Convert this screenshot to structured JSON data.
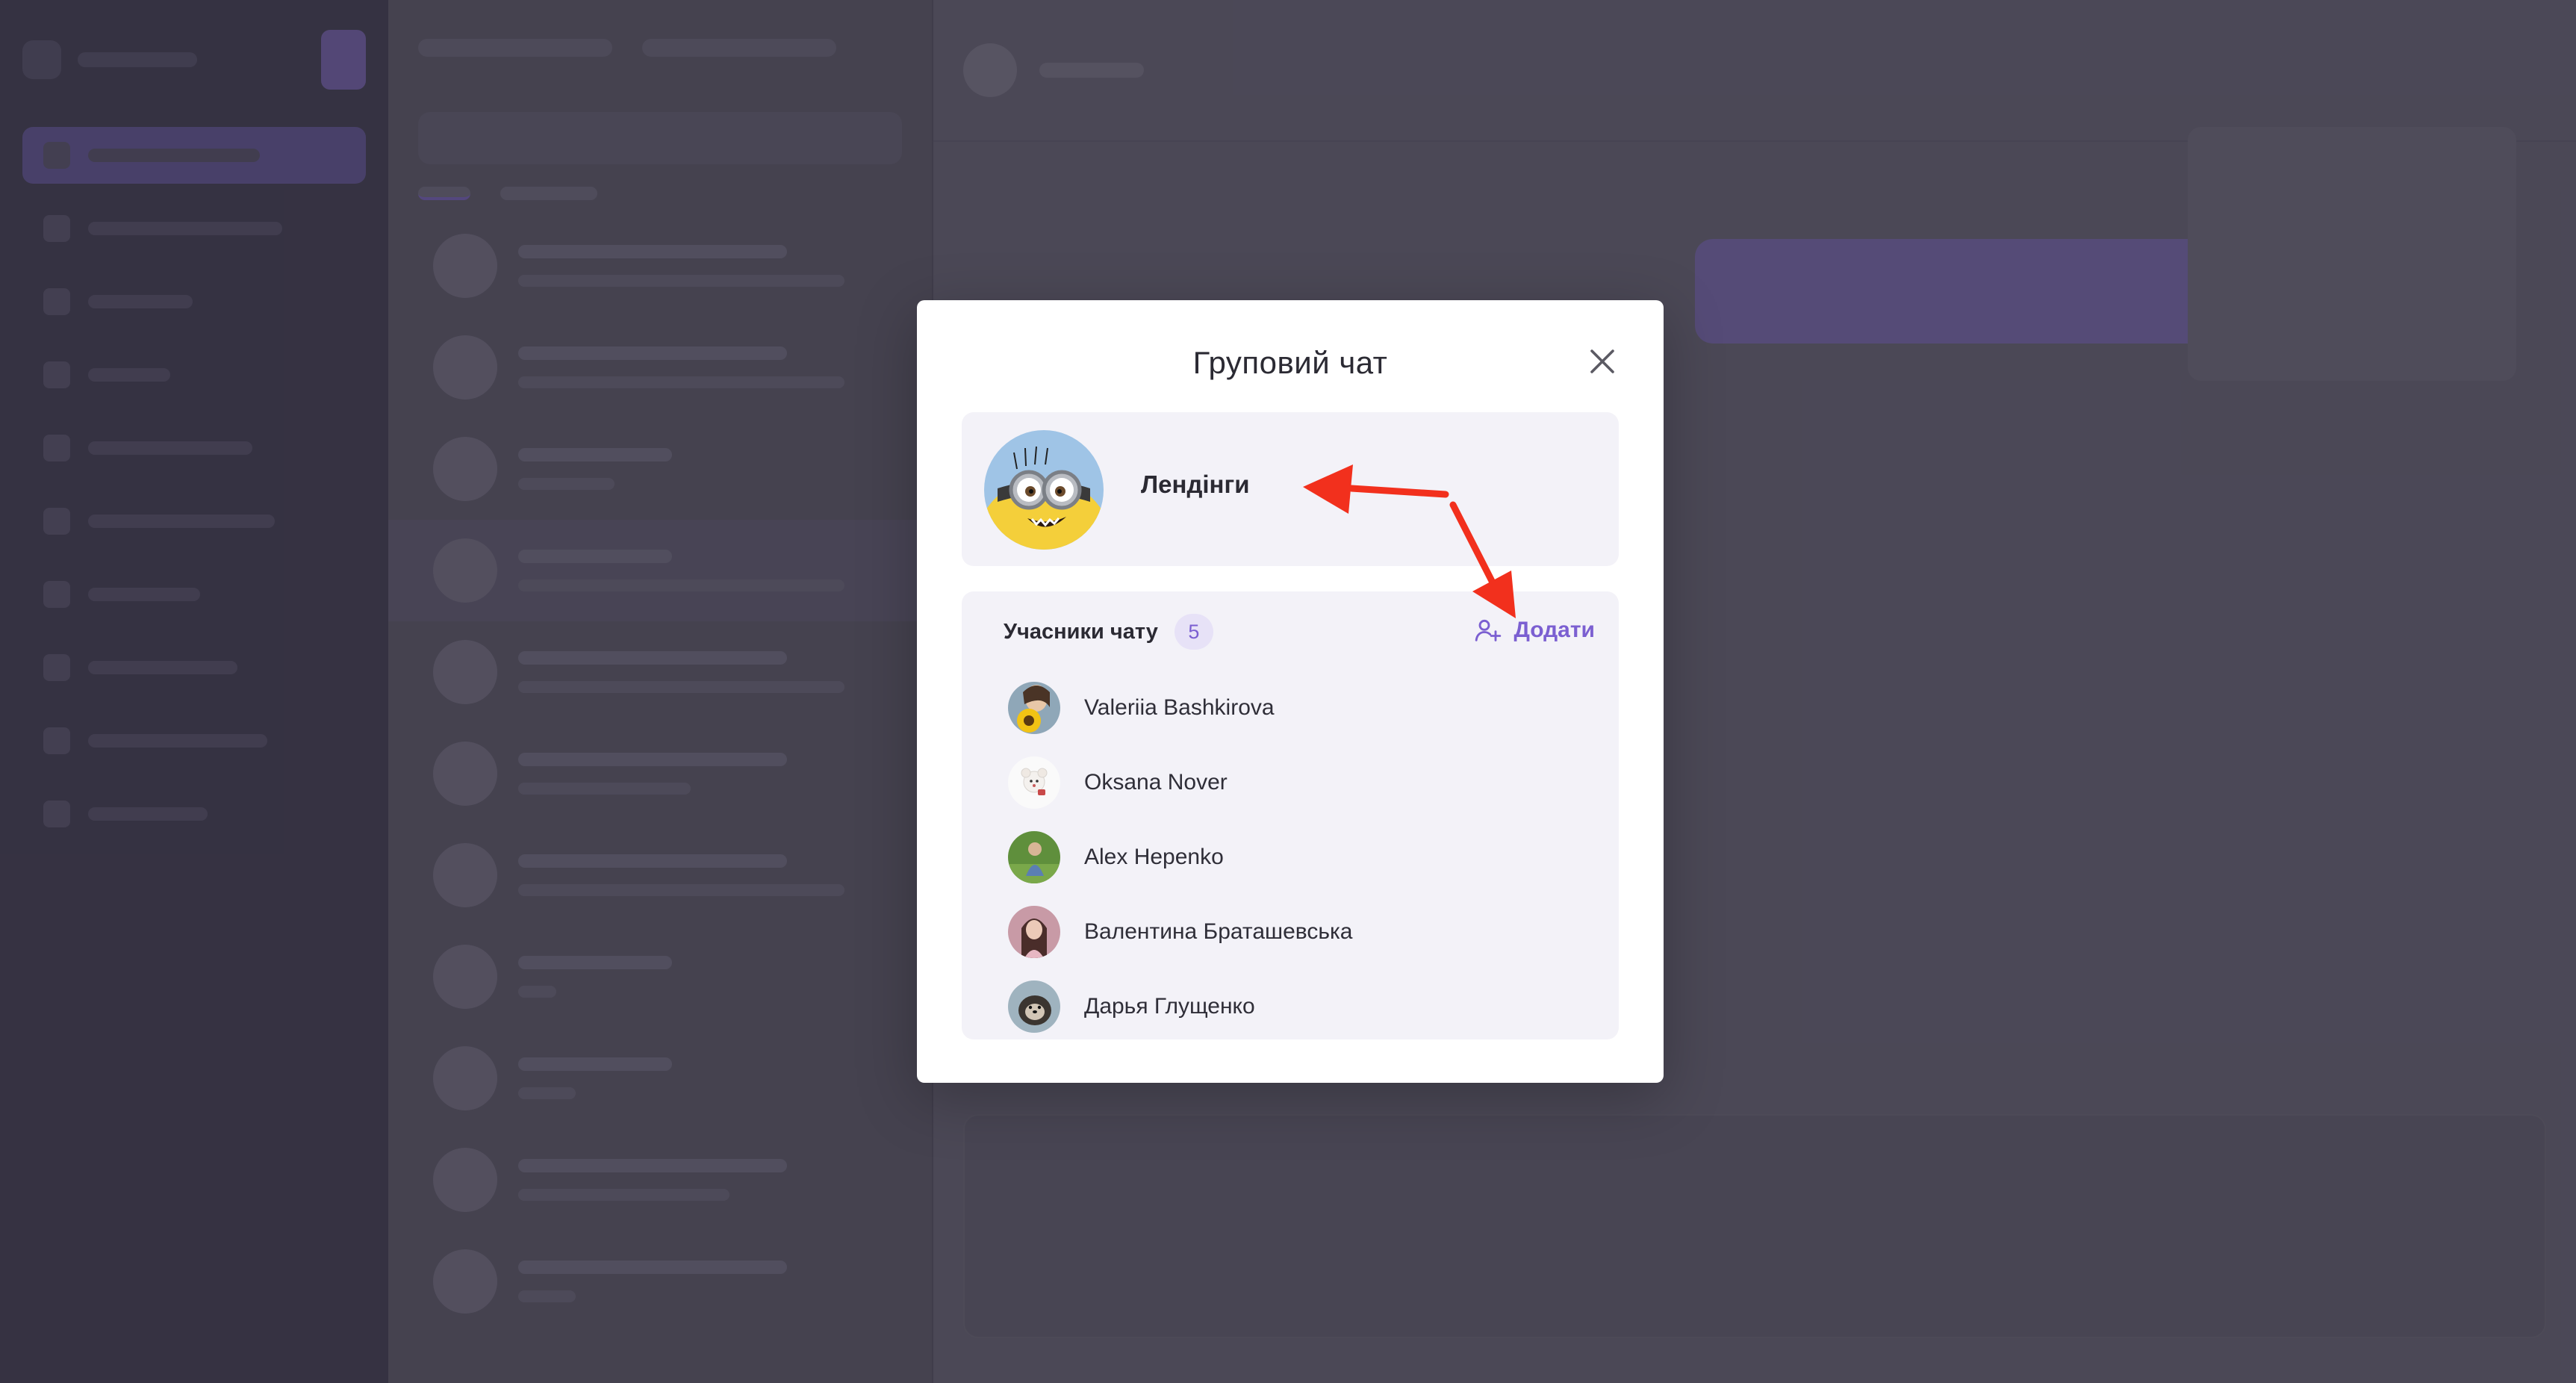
{
  "modal": {
    "title": "Груповий чат",
    "close_icon": "close-icon"
  },
  "group": {
    "name": "Лендінги",
    "avatar_icon": "minion-avatar",
    "edit_icon": "pencil-icon"
  },
  "members": {
    "title": "Учасники чату",
    "count": "5",
    "add_label": "Додати",
    "add_icon": "user-plus-icon",
    "list": [
      {
        "name": "Valeriia Bashkirova",
        "avatar": "sunflower-photo"
      },
      {
        "name": "Oksana Nover",
        "avatar": "toy-photo"
      },
      {
        "name": "Alex Hepenko",
        "avatar": "outdoor-photo"
      },
      {
        "name": "Валентина Браташевська",
        "avatar": "portrait-photo"
      },
      {
        "name": "Дарья Глущенко",
        "avatar": "otter-photo"
      }
    ]
  },
  "colors": {
    "accent": "#7b5fd1",
    "annotation_arrow": "#f2301d",
    "card_bg": "#f3f2f8"
  }
}
